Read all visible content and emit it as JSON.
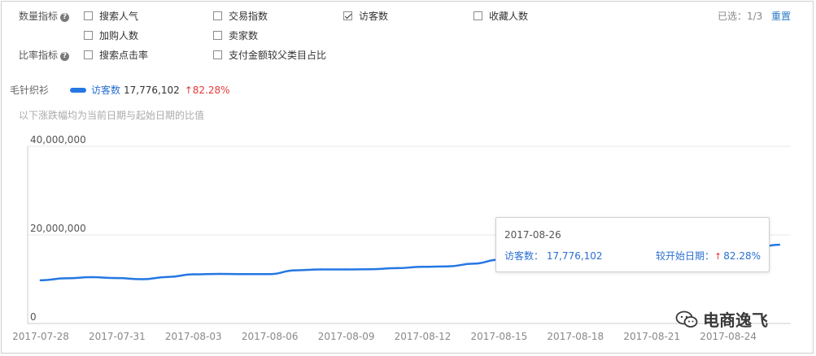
{
  "filters": {
    "quantity_label": "数量指标",
    "ratio_label": "比率指标",
    "help": "?",
    "options": [
      {
        "label": "搜索人气",
        "checked": false
      },
      {
        "label": "交易指数",
        "checked": false
      },
      {
        "label": "访客数",
        "checked": true
      },
      {
        "label": "收藏人数",
        "checked": false
      },
      {
        "label": "加购人数",
        "checked": false
      },
      {
        "label": "卖家数",
        "checked": false
      },
      {
        "label": "搜索点击率",
        "checked": false
      },
      {
        "label": "支付金额较父类目占比",
        "checked": false
      }
    ],
    "selected_info": "已选：1/3",
    "reset": "重置"
  },
  "legend": {
    "category": "毛针织衫",
    "series_name": "访客数",
    "value": "17,776,102",
    "change": "82.28%",
    "change_arrow": "↑",
    "note": "以下涨跌幅均为当前日期与起始日期的比值"
  },
  "tooltip": {
    "date": "2017-08-26",
    "metric": "访客数：",
    "value": "17,776,102",
    "compare_label": "较开始日期：",
    "arrow": "↑",
    "change": "82.28%"
  },
  "watermark": {
    "text": "电商逸飞",
    "icon": "wechat-icon"
  },
  "colors": {
    "series": "#2577e3",
    "accent": "#2a7ac7",
    "up": "#e03a3a"
  },
  "chart_data": {
    "type": "line",
    "title": "",
    "xlabel": "",
    "ylabel": "",
    "ylim": [
      0,
      40000000
    ],
    "yticks": [
      "0",
      "20,000,000",
      "40,000,000"
    ],
    "xtick_labels": [
      "2017-07-28",
      "2017-07-31",
      "2017-08-03",
      "2017-08-06",
      "2017-08-09",
      "2017-08-12",
      "2017-08-15",
      "2017-08-18",
      "2017-08-21",
      "2017-08-24"
    ],
    "grid": true,
    "x": [
      "2017-07-28",
      "2017-07-29",
      "2017-07-30",
      "2017-07-31",
      "2017-08-01",
      "2017-08-02",
      "2017-08-03",
      "2017-08-04",
      "2017-08-05",
      "2017-08-06",
      "2017-08-07",
      "2017-08-08",
      "2017-08-09",
      "2017-08-10",
      "2017-08-11",
      "2017-08-12",
      "2017-08-13",
      "2017-08-14",
      "2017-08-15",
      "2017-08-16",
      "2017-08-17",
      "2017-08-18",
      "2017-08-19",
      "2017-08-20",
      "2017-08-21",
      "2017-08-22",
      "2017-08-23",
      "2017-08-24",
      "2017-08-25",
      "2017-08-26"
    ],
    "series": [
      {
        "name": "访客数",
        "values": [
          9750000,
          10200000,
          10450000,
          10250000,
          10000000,
          10500000,
          11100000,
          11200000,
          11150000,
          11150000,
          12000000,
          12200000,
          12200000,
          12250000,
          12500000,
          12800000,
          12900000,
          13500000,
          14400000,
          14600000,
          15000000,
          15200000,
          15300000,
          15400000,
          15500000,
          15700000,
          15900000,
          16400000,
          17000000,
          17776102
        ]
      }
    ]
  }
}
